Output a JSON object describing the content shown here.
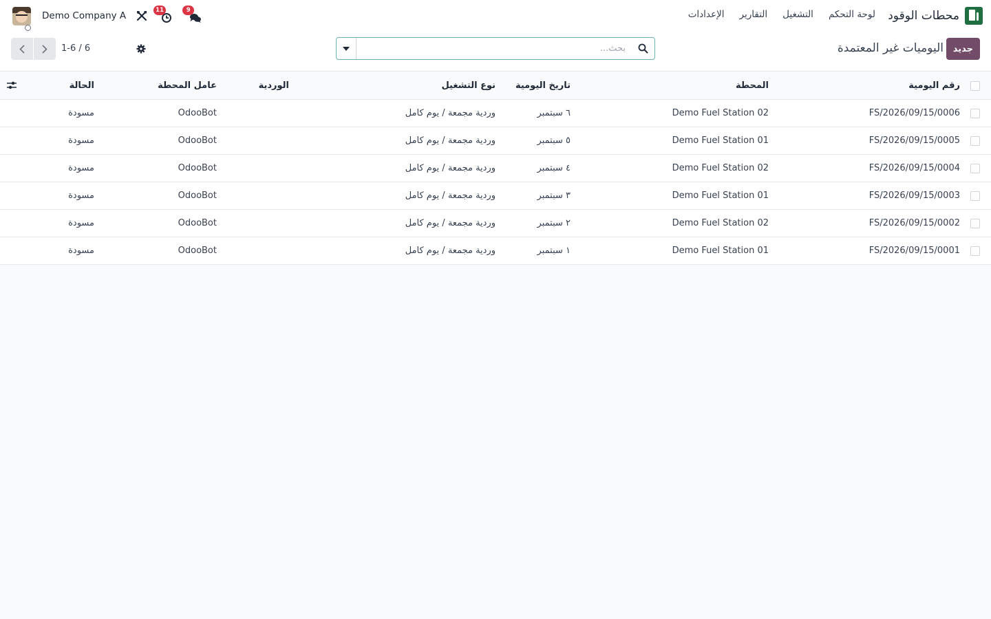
{
  "navbar": {
    "app_name": "محطات الوقود",
    "menu": [
      "لوحة التحكم",
      "التشغيل",
      "التقارير",
      "الإعدادات"
    ],
    "company": "Demo Company A",
    "activity_count": "11",
    "messages_count": "9"
  },
  "control_panel": {
    "new_button": "جديد",
    "title": "اليوميات غير المعتمدة",
    "search_placeholder": "بحث...",
    "pager": "1-6 / 6"
  },
  "table": {
    "headers": {
      "number": "رقم اليومية",
      "station": "المحطة",
      "date": "تاريخ اليومية",
      "type": "نوع التشغيل",
      "shift": "الوردية",
      "worker": "عامل المحطة",
      "state": "الحالة"
    },
    "rows": [
      {
        "number": "FS/2026/09/15/0006",
        "station": "Demo Fuel Station 02",
        "date": "٦ سبتمبر",
        "type": "وردية مجمعة / يوم كامل",
        "shift": "",
        "worker": "OdooBot",
        "state": "مسودة"
      },
      {
        "number": "FS/2026/09/15/0005",
        "station": "Demo Fuel Station 01",
        "date": "٥ سبتمبر",
        "type": "وردية مجمعة / يوم كامل",
        "shift": "",
        "worker": "OdooBot",
        "state": "مسودة"
      },
      {
        "number": "FS/2026/09/15/0004",
        "station": "Demo Fuel Station 02",
        "date": "٤ سبتمبر",
        "type": "وردية مجمعة / يوم كامل",
        "shift": "",
        "worker": "OdooBot",
        "state": "مسودة"
      },
      {
        "number": "FS/2026/09/15/0003",
        "station": "Demo Fuel Station 01",
        "date": "٣ سبتمبر",
        "type": "وردية مجمعة / يوم كامل",
        "shift": "",
        "worker": "OdooBot",
        "state": "مسودة"
      },
      {
        "number": "FS/2026/09/15/0002",
        "station": "Demo Fuel Station 02",
        "date": "٢ سبتمبر",
        "type": "وردية مجمعة / يوم كامل",
        "shift": "",
        "worker": "OdooBot",
        "state": "مسودة"
      },
      {
        "number": "FS/2026/09/15/0001",
        "station": "Demo Fuel Station 01",
        "date": "١ سبتمبر",
        "type": "وردية مجمعة / يوم كامل",
        "shift": "",
        "worker": "OdooBot",
        "state": "مسودة"
      }
    ]
  },
  "colors": {
    "primary": "#714b67",
    "brand_logo": "#1f6f43",
    "badge": "#dc3545",
    "search_border": "#6bb3b0"
  },
  "icons": [
    "fuel-station-logo-icon",
    "avatar",
    "tools-icon",
    "activity-clock-icon",
    "chat-icon",
    "gear-icon",
    "caret-down-icon",
    "search-icon",
    "chevron-left-icon",
    "chevron-right-icon",
    "column-settings-icon"
  ]
}
